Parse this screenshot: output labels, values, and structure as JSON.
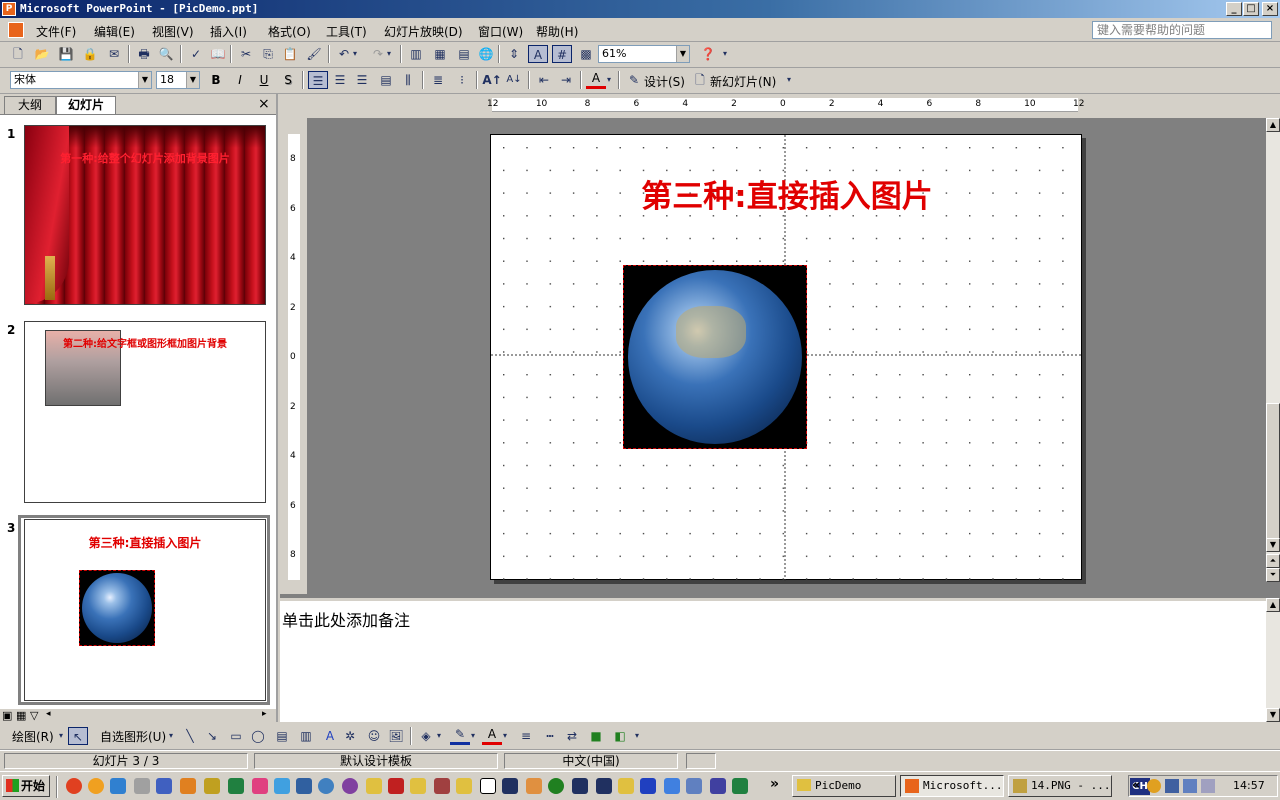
{
  "window": {
    "title": "Microsoft PowerPoint - [PicDemo.ppt]",
    "app_icon": "powerpoint-icon",
    "buttons": [
      "_",
      "□",
      "×"
    ]
  },
  "menu": {
    "items": [
      "文件(F)",
      "编辑(E)",
      "视图(V)",
      "插入(I)",
      "格式(O)",
      "工具(T)",
      "幻灯片放映(D)",
      "窗口(W)",
      "帮助(H)"
    ],
    "help_placeholder": "键入需要帮助的问题"
  },
  "standard_toolbar": {
    "zoom": "61%"
  },
  "format_toolbar": {
    "font": "宋体",
    "size": "18",
    "bold": "B",
    "italic": "I",
    "underline": "U",
    "shadow": "S",
    "design_label": "设计(S)",
    "new_slide_label": "新幻灯片(N)"
  },
  "left_pane": {
    "tabs": [
      "大纲",
      "幻灯片"
    ],
    "active_tab": "幻灯片",
    "close": "×",
    "slides": [
      {
        "num": "1",
        "title": "第一种:给整个幻灯片添加背景图片",
        "background": "red-curtain"
      },
      {
        "num": "2",
        "title": "第二种:给文字框或图形框加图片背景"
      },
      {
        "num": "3",
        "title": "第三种:直接插入图片",
        "selected": true
      }
    ]
  },
  "ruler": {
    "h_ticks": [
      "12",
      "10",
      "8",
      "6",
      "4",
      "2",
      "0",
      "2",
      "4",
      "6",
      "8",
      "10",
      "12"
    ],
    "v_ticks": [
      "8",
      "6",
      "4",
      "2",
      "0",
      "2",
      "4",
      "6",
      "8"
    ]
  },
  "slide": {
    "title": "第三种:直接插入图片",
    "title_color": "#e00000",
    "image": "earth-photo"
  },
  "notes": {
    "placeholder": "单击此处添加备注"
  },
  "drawing_toolbar": {
    "draw_label": "绘图(R)",
    "autoshape_label": "自选图形(U)"
  },
  "status": {
    "slide": "幻灯片 3 / 3",
    "template": "默认设计模板",
    "language": "中文(中国)"
  },
  "taskbar": {
    "start": "开始",
    "buttons": [
      "PicDemo",
      "Microsoft...",
      "14.PNG - ..."
    ],
    "active_button": 1,
    "ime": "CH",
    "clock": "14:57",
    "more": "»",
    "tray_more": "«"
  }
}
